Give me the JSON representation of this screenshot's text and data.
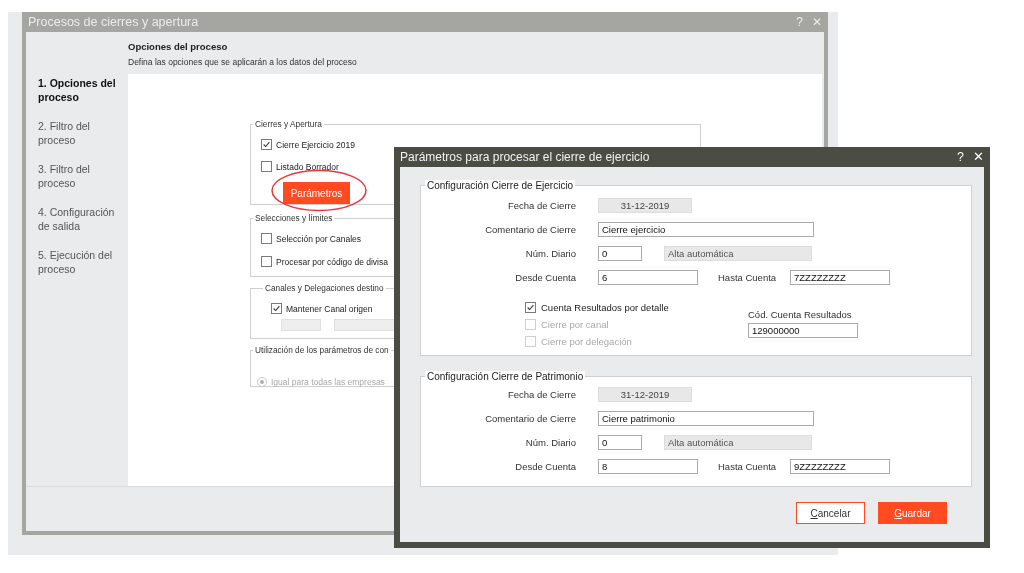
{
  "window": {
    "title": "Procesos de cierres y apertura",
    "help": "?",
    "close": "✕"
  },
  "steps": [
    {
      "label": "1. Opciones del proceso",
      "selected": true
    },
    {
      "label": "2. Filtro del proceso",
      "selected": false
    },
    {
      "label": "3. Filtro del proceso",
      "selected": false
    },
    {
      "label": "4. Configuración de salida",
      "selected": false
    },
    {
      "label": "5. Ejecución del proceso",
      "selected": false
    }
  ],
  "header": {
    "title": "Opciones del proceso",
    "subtitle": "Defina las opciones que se aplicarán a los datos del proceso"
  },
  "groups": [
    {
      "title": "Cierres y Apertura",
      "items": [
        {
          "kind": "checkbox",
          "label": "Cierre Ejercicio 2019",
          "checked": true
        },
        {
          "kind": "checkbox",
          "label": "Listado Borrador",
          "checked": false
        },
        {
          "kind": "button",
          "label": "Parámetros"
        }
      ]
    },
    {
      "title": "Selecciones y límites",
      "items": [
        {
          "kind": "checkbox",
          "label": "Selección por Canales",
          "checked": false
        },
        {
          "kind": "checkbox",
          "label": "Procesar por código de divisa",
          "checked": false
        }
      ]
    },
    {
      "title": "Canales y Delegaciones destino",
      "items": [
        {
          "kind": "checkbox",
          "label": "Mantener Canal origen",
          "checked": true
        },
        {
          "kind": "blank_fields"
        }
      ]
    },
    {
      "title": "Utilización de los parámetros de con",
      "items": [
        {
          "kind": "radio",
          "label": "Igual para todas las empresas",
          "selected": true,
          "disabled": true
        }
      ]
    }
  ],
  "dialog": {
    "title": "Parámetros para procesar el cierre de ejercicio",
    "help": "?",
    "close": "✕",
    "sections": [
      {
        "title": "Configuración Cierre de Ejercicio",
        "rows": [
          [
            {
              "label": "Fecha de Cierre",
              "value": "31-12-2019",
              "kind": "date"
            }
          ],
          [
            {
              "label": "Comentario de Cierre",
              "value": "Cierre ejercicio",
              "kind": "wide"
            }
          ],
          [
            {
              "label": "Núm. Diario",
              "value": "0",
              "kind": "short"
            },
            {
              "value": "Alta automática",
              "kind": "info"
            }
          ],
          [
            {
              "label": "Desde Cuenta",
              "value": "6",
              "kind": "medium"
            },
            {
              "label": "Hasta Cuenta",
              "value": "7ZZZZZZZZ",
              "kind": "medium"
            }
          ]
        ],
        "checks": [
          {
            "label": "Cuenta Resultados por detalle",
            "checked": true,
            "disabled": false
          },
          {
            "label": "Cierre por canal",
            "checked": false,
            "disabled": true
          },
          {
            "label": "Cierre por delegación",
            "checked": false,
            "disabled": true
          }
        ],
        "result_account": {
          "label": "Cód. Cuenta Resultados",
          "value": "129000000"
        }
      },
      {
        "title": "Configuración Cierre de Patrimonio",
        "rows": [
          [
            {
              "label": "Fecha de Cierre",
              "value": "31-12-2019",
              "kind": "date"
            }
          ],
          [
            {
              "label": "Comentario de Cierre",
              "value": "Cierre patrimonio",
              "kind": "wide"
            }
          ],
          [
            {
              "label": "Núm. Diario",
              "value": "0",
              "kind": "short"
            },
            {
              "value": "Alta automática",
              "kind": "info"
            }
          ],
          [
            {
              "label": "Desde Cuenta",
              "value": "8",
              "kind": "medium"
            },
            {
              "label": "Hasta Cuenta",
              "value": "9ZZZZZZZZ",
              "kind": "medium"
            }
          ]
        ]
      }
    ],
    "buttons": [
      {
        "label": "Cancelar",
        "kind": "secondary"
      },
      {
        "label": "Guardar",
        "kind": "primary"
      }
    ]
  }
}
